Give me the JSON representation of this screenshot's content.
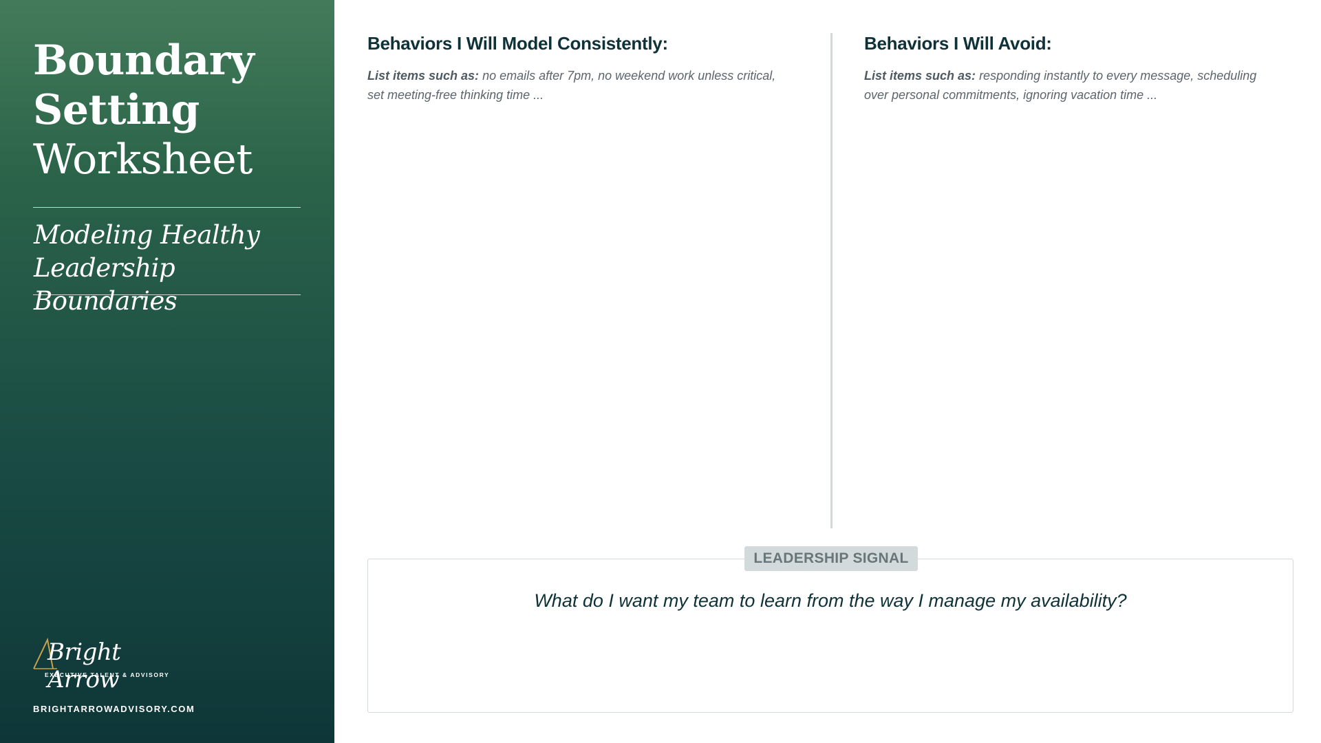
{
  "sidebar": {
    "title_line1": "Boundary",
    "title_line2": "Setting",
    "title_line3": "Worksheet",
    "subtitle_line1": "Modeling Healthy",
    "subtitle_line2": "Leadership Boundaries",
    "logo_script": "Bright Arrow",
    "logo_tagline": "EXECUTIVE TALENT & ADVISORY",
    "website": "BRIGHTARROWADVISORY.COM"
  },
  "left_column": {
    "heading": "Behaviors I Will Model Consistently:",
    "hint_label": "List items such as:",
    "hint_text": " no emails after 7pm, no weekend work unless critical, set meeting-free thinking time ..."
  },
  "right_column": {
    "heading": "Behaviors I Will Avoid:",
    "hint_label": "List items such as:",
    "hint_text": " responding instantly to every message, scheduling over personal commitments, ignoring vacation time ..."
  },
  "signal": {
    "tag": "LEADERSHIP SIGNAL",
    "question": "What do I want my team to learn from the way I manage my availability?"
  },
  "colors": {
    "sidebar_top": "#437b5a",
    "sidebar_bottom": "#0e3638",
    "heading": "#0f3138",
    "logo_gold": "#c9a24a"
  }
}
